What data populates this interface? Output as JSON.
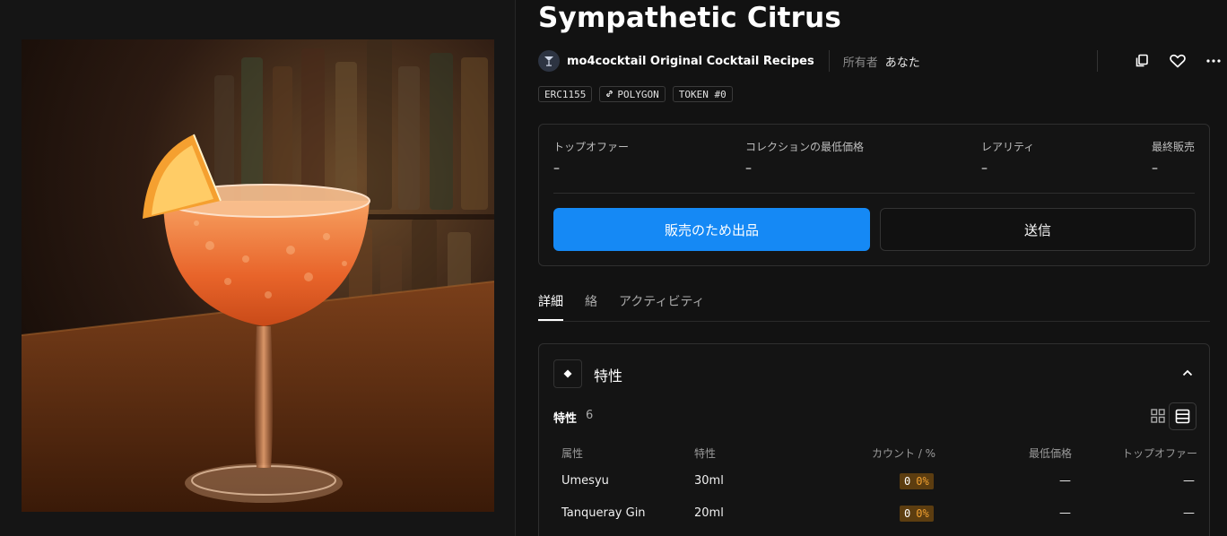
{
  "nft": {
    "title": "Sympathetic Citrus",
    "collection_name": "mo4cocktail Original Cocktail Recipes",
    "collection_icon": "cocktail-glass-icon",
    "owner_label": "所有者",
    "owner_name": "あなた"
  },
  "chips": {
    "standard": "ERC1155",
    "chain": "POLYGON",
    "token": "TOKEN #0"
  },
  "stats": {
    "top_offer_label": "トップオファー",
    "top_offer_value": "–",
    "floor_label": "コレクションの最低価格",
    "floor_value": "–",
    "rarity_label": "レアリティ",
    "rarity_value": "–",
    "last_sale_label": "最終販売",
    "last_sale_value": "–"
  },
  "actions": {
    "list_for_sale": "販売のため出品",
    "transfer": "送信"
  },
  "tabs": {
    "details": "詳細",
    "orders": "絡",
    "activity": "アクティビティ"
  },
  "traits": {
    "header": "特性",
    "count_label": "特性",
    "count": "6",
    "columns": {
      "attribute": "属性",
      "trait": "特性",
      "count_pct": "カウント / %",
      "floor": "最低価格",
      "top_offer": "トップオファー"
    },
    "rows": [
      {
        "attribute": "Umesyu",
        "trait": "30ml",
        "count": "0",
        "percent": "0%",
        "floor": "—",
        "top_offer": "—"
      },
      {
        "attribute": "Tanqueray Gin",
        "trait": "20ml",
        "count": "0",
        "percent": "0%",
        "floor": "—",
        "top_offer": "—"
      }
    ]
  },
  "colors": {
    "accent": "#1589f5",
    "background": "#121212",
    "badge_bg": "#5c3d10",
    "badge_pct": "#f0a030"
  }
}
